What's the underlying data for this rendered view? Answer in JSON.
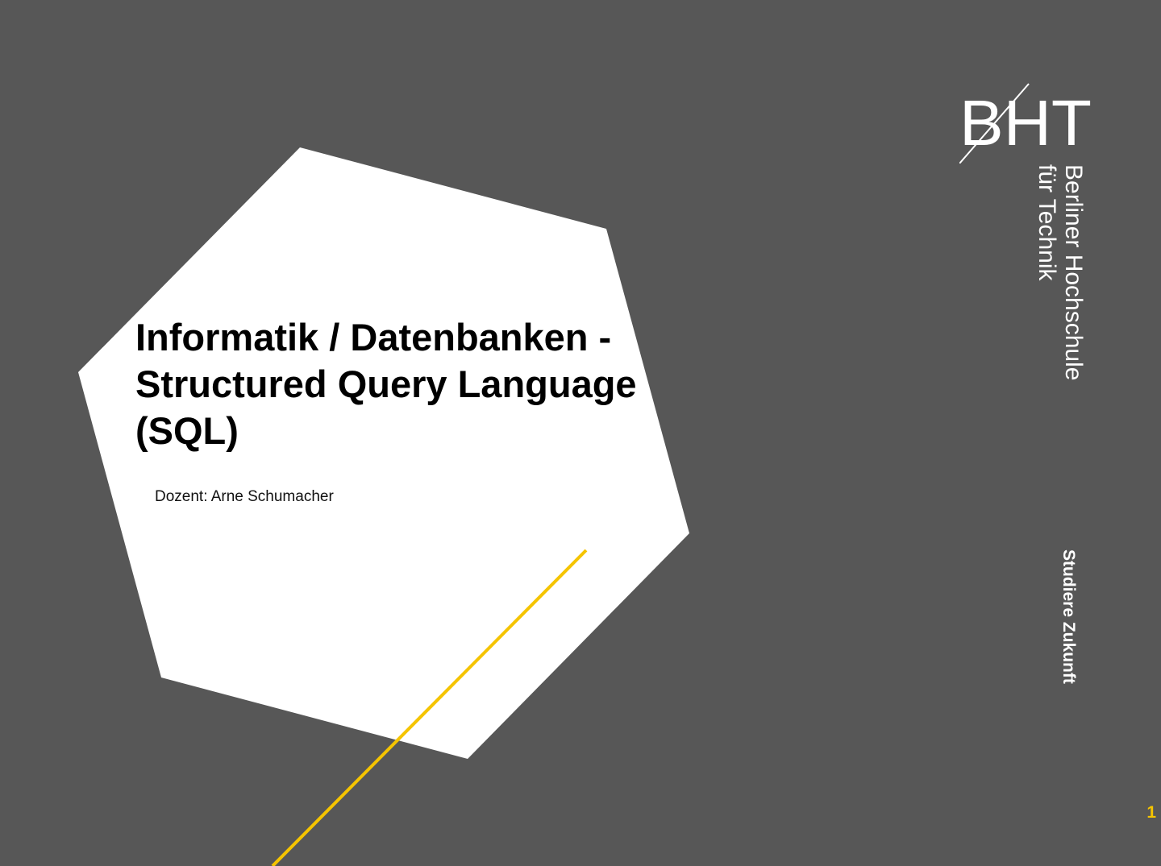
{
  "slide": {
    "title_lines": [
      "Informatik / Datenbanken -",
      "Structured Query Language",
      "(SQL)"
    ],
    "lecturer": "Dozent: Arne Schumacher",
    "page_number": "1"
  },
  "logo": {
    "letters": "BHT",
    "line1": "Berliner Hochschule",
    "line2": "für Technik",
    "slogan": "Studiere Zukunft"
  },
  "colors": {
    "background": "#575757",
    "hexagon": "#ffffff",
    "accent": "#f5c400",
    "title_text": "#000000",
    "logo": "#ffffff"
  }
}
